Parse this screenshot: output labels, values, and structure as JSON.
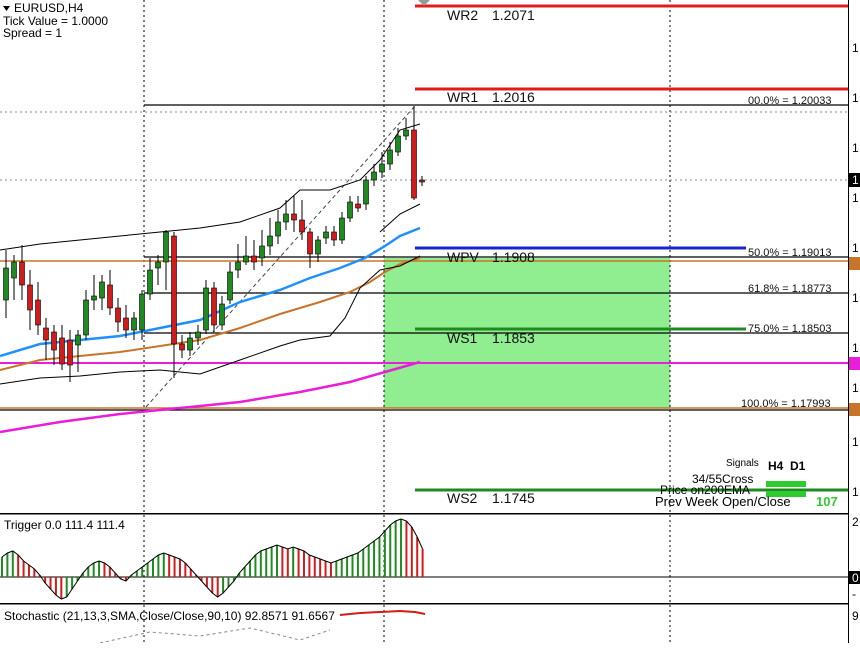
{
  "header": {
    "symbol": "EURUSD,H4",
    "tick_value": "Tick Value = 1.0000",
    "spread": "Spread = 1"
  },
  "pivot_levels": [
    {
      "name": "WR2",
      "value": "1.2071",
      "color": "#e11b1b"
    },
    {
      "name": "WR1",
      "value": "1.2016",
      "color": "#e11b1b"
    },
    {
      "name": "WPV",
      "value": "1.1908",
      "color": "#1a24c8"
    },
    {
      "name": "WS1",
      "value": "1.1853",
      "color": "#1f8a1f"
    },
    {
      "name": "WS2",
      "value": "1.1745",
      "color": "#1f8a1f"
    }
  ],
  "fib_levels": [
    {
      "label": "00.0% = 1.20033"
    },
    {
      "label": "50.0% = 1.19013"
    },
    {
      "label": "61.8% = 1.18773"
    },
    {
      "label": "75.0% = 1.18503"
    },
    {
      "label": "100.0% = 1.17993"
    }
  ],
  "signals": {
    "title": "Signals",
    "col_h4": "H4",
    "col_d1": "D1",
    "rows": [
      "34/55Cross",
      "Price on200EMA",
      "Prev Week Open/Close"
    ],
    "prev_week_value": "107"
  },
  "indicators": {
    "trigger_label": "Trigger 0.0 111.4 111.4",
    "stochastic_label": "Stochastic (21,13,3,SMA,Close/Close,90,10) 92.8571 91.6567"
  },
  "right_axis": {
    "main_labels": [
      "1",
      "1",
      "1",
      "1",
      "1",
      "1",
      "1",
      "1",
      "1",
      "1",
      "1",
      "1",
      "1",
      "1"
    ],
    "trigger_labels": [
      "2",
      "0",
      "-"
    ],
    "stoch_labels": [
      "9"
    ]
  },
  "colors": {
    "bull": "#1f8a1f",
    "bear": "#d21b1b",
    "ema_blue": "#1e90ff",
    "ema_brown": "#c8742a",
    "ema_magenta": "#e81ed8",
    "green_zone": "#90ee90"
  },
  "icons": {
    "dropdown": "triangle-down-icon"
  }
}
